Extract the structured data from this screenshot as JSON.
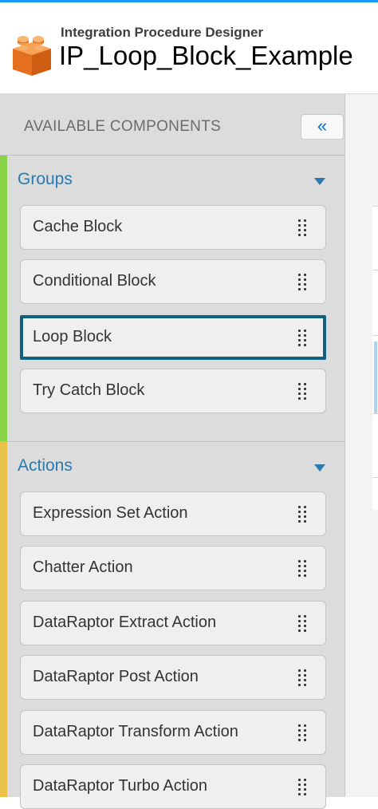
{
  "header": {
    "subtitle": "Integration Procedure Designer",
    "title": "IP_Loop_Block_Example",
    "logo_icon": "orange-brick-icon"
  },
  "panel": {
    "title": "AVAILABLE COMPONENTS",
    "collapse_label": "«"
  },
  "groups": {
    "title": "Groups",
    "accent_color": "#8ad44a",
    "items": [
      {
        "label": "Cache Block",
        "selected": false
      },
      {
        "label": "Conditional Block",
        "selected": false
      },
      {
        "label": "Loop Block",
        "selected": true
      },
      {
        "label": "Try Catch Block",
        "selected": false
      }
    ]
  },
  "actions": {
    "title": "Actions",
    "accent_color": "#e9c04a",
    "items": [
      {
        "label": "Expression Set Action"
      },
      {
        "label": "Chatter Action"
      },
      {
        "label": "DataRaptor Extract Action"
      },
      {
        "label": "DataRaptor Post Action"
      },
      {
        "label": "DataRaptor Transform Action"
      },
      {
        "label": "DataRaptor Turbo Action"
      }
    ]
  },
  "colors": {
    "section_title": "#2a7ab0",
    "selected_border": "#10607f",
    "collapse_icon": "#0070d2"
  }
}
